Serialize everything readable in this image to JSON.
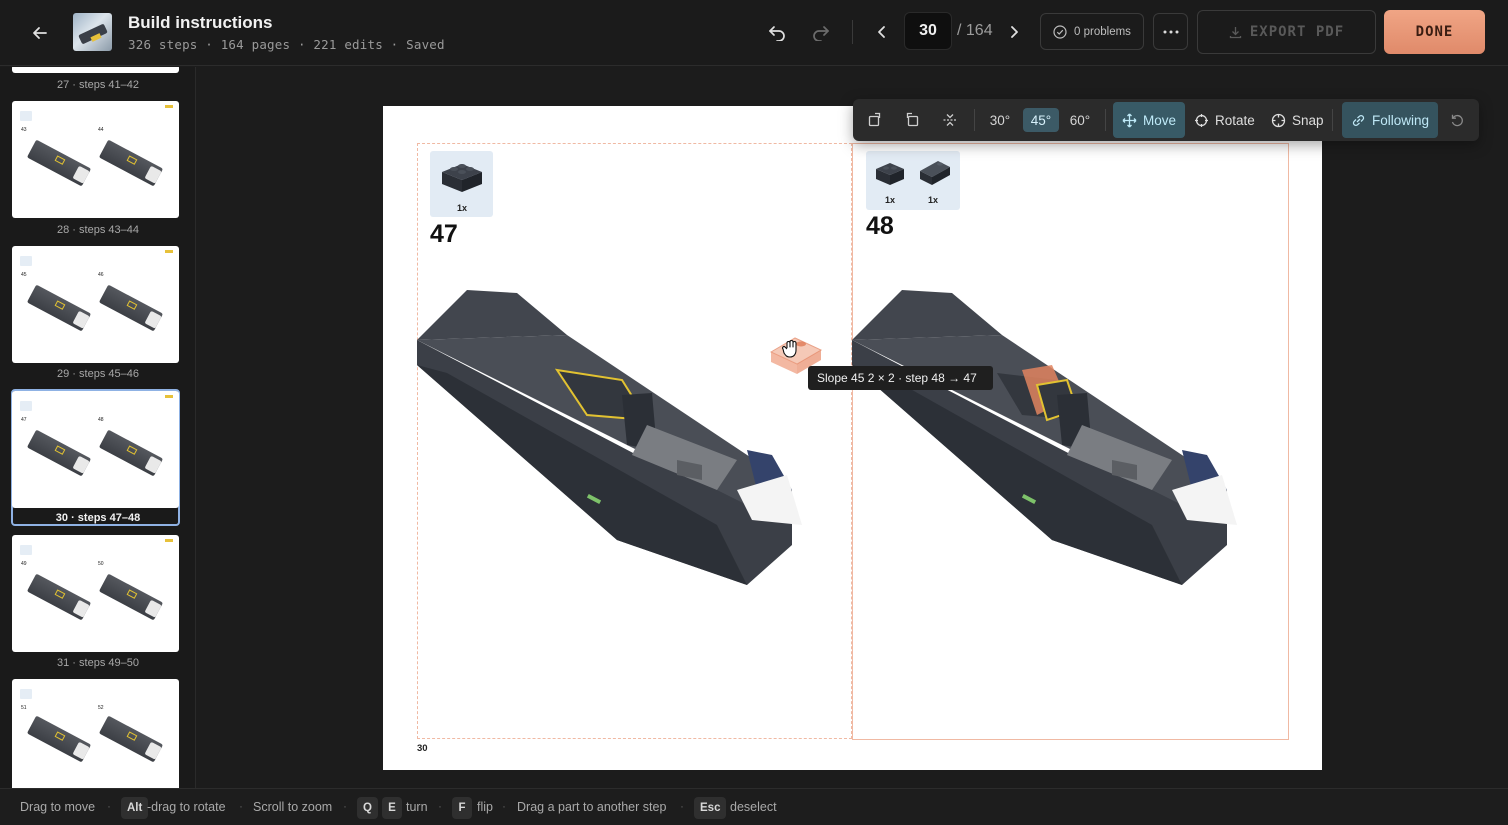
{
  "header": {
    "title": "Build instructions",
    "meta": "326 steps · 164 pages · 221 edits · Saved",
    "page_current": "30",
    "page_total": "/ 164",
    "problems_label": "0 problems",
    "export_label": "EXPORT PDF",
    "done_label": "DONE"
  },
  "sidebar": {
    "pages": [
      {
        "caption": "27 · steps 41–42"
      },
      {
        "caption": "28 · steps 43–44",
        "steps": [
          "43",
          "44"
        ]
      },
      {
        "caption": "29 · steps 45–46",
        "steps": [
          "45",
          "46"
        ]
      },
      {
        "caption": "30 · steps 47–48",
        "steps": [
          "47",
          "48"
        ],
        "selected": true
      },
      {
        "caption": "31 · steps 49–50",
        "steps": [
          "49",
          "50"
        ]
      },
      {
        "caption": "",
        "steps": [
          "51",
          "52"
        ]
      }
    ]
  },
  "canvas": {
    "page_number": "30",
    "steps": [
      {
        "number": "47",
        "parts": [
          {
            "qty": "1x"
          }
        ]
      },
      {
        "number": "48",
        "parts": [
          {
            "qty": "1x"
          },
          {
            "qty": "1x"
          }
        ]
      }
    ],
    "tooltip": "Slope 45 2 × 2 · step 48 → 47"
  },
  "toolbar": {
    "angles": [
      "30°",
      "45°",
      "60°"
    ],
    "active_angle": "45°",
    "move_label": "Move",
    "rotate_label": "Rotate",
    "snap_label": "Snap",
    "following_label": "Following"
  },
  "statusbar": {
    "drag_move": "Drag to move",
    "alt_key": "Alt",
    "alt_text": "-drag to rotate",
    "scroll_zoom": "Scroll to zoom",
    "q_key": "Q",
    "e_key": "E",
    "turn_text": "turn",
    "f_key": "F",
    "flip_text": "flip",
    "drag_part": "Drag a part to another step",
    "esc_key": "Esc",
    "deselect_text": "deselect"
  },
  "colors": {
    "accent_done": "#e08a6a",
    "active_blue": "#385a66",
    "selection_outline": "#8fb2e4",
    "step_frame": "#f0b9a3",
    "highlight_yellow": "#e2c231"
  }
}
